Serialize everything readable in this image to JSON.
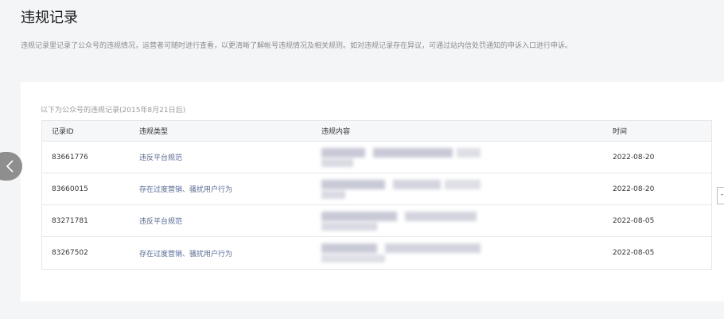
{
  "page": {
    "title": "违规记录",
    "description": "违规记录里记录了公众号的违规情况，运营者可随时进行查看，以更清晰了解帐号违规情况及相关规则。如对违规记录存在异议，可通过站内信处罚通知的申诉入口进行申诉。"
  },
  "records": {
    "note": "以下为公众号的违规记录(2015年8月21日后)",
    "columns": {
      "id": "记录ID",
      "type": "违规类型",
      "content": "违规内容",
      "time": "时间"
    },
    "rows": [
      {
        "id": "83661776",
        "type": "违反平台规范",
        "time": "2022-08-20"
      },
      {
        "id": "83660015",
        "type": "存在过度营销、骚扰用户行为",
        "time": "2022-08-20"
      },
      {
        "id": "83271781",
        "type": "违反平台规范",
        "time": "2022-08-05"
      },
      {
        "id": "83267502",
        "type": "存在过度营销、骚扰用户行为",
        "time": "2022-08-05"
      }
    ]
  },
  "nav": {
    "prev_icon": "chevron-left-icon",
    "side_tab_label": "-"
  },
  "colors": {
    "background": "#f4f5f7",
    "card": "#ffffff",
    "link": "#576b95",
    "nav_button": "#8e8e8e"
  }
}
